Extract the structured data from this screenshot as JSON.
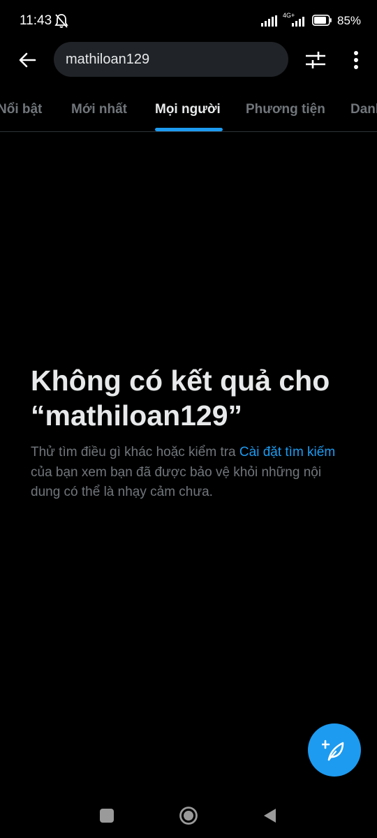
{
  "status_bar": {
    "time": "11:43",
    "network": "4G+",
    "battery": "85%"
  },
  "search": {
    "query": "mathiloan129"
  },
  "tabs": [
    {
      "label": "Nổi bật",
      "active": false
    },
    {
      "label": "Mới nhất",
      "active": false
    },
    {
      "label": "Mọi người",
      "active": true
    },
    {
      "label": "Phương tiện",
      "active": false
    },
    {
      "label": "Danh sách",
      "active": false
    }
  ],
  "empty_state": {
    "title": "Không có kết quả cho “mathiloan129”",
    "desc_before": "Thử tìm điều gì khác hoặc kiểm tra ",
    "desc_link": "Cài đặt tìm kiếm",
    "desc_after": " của bạn xem bạn đã được bảo vệ khỏi những nội dung có thể là nhạy cảm chưa."
  },
  "icons": {
    "back": "arrow-left-icon",
    "filter": "filter-sliders-icon",
    "more": "more-vertical-icon",
    "fab": "compose-feather-icon"
  },
  "colors": {
    "background": "#000000",
    "accent": "#1d9bf0",
    "text_primary": "#e7e9ea",
    "text_secondary": "#71767b",
    "search_box": "#202327"
  }
}
